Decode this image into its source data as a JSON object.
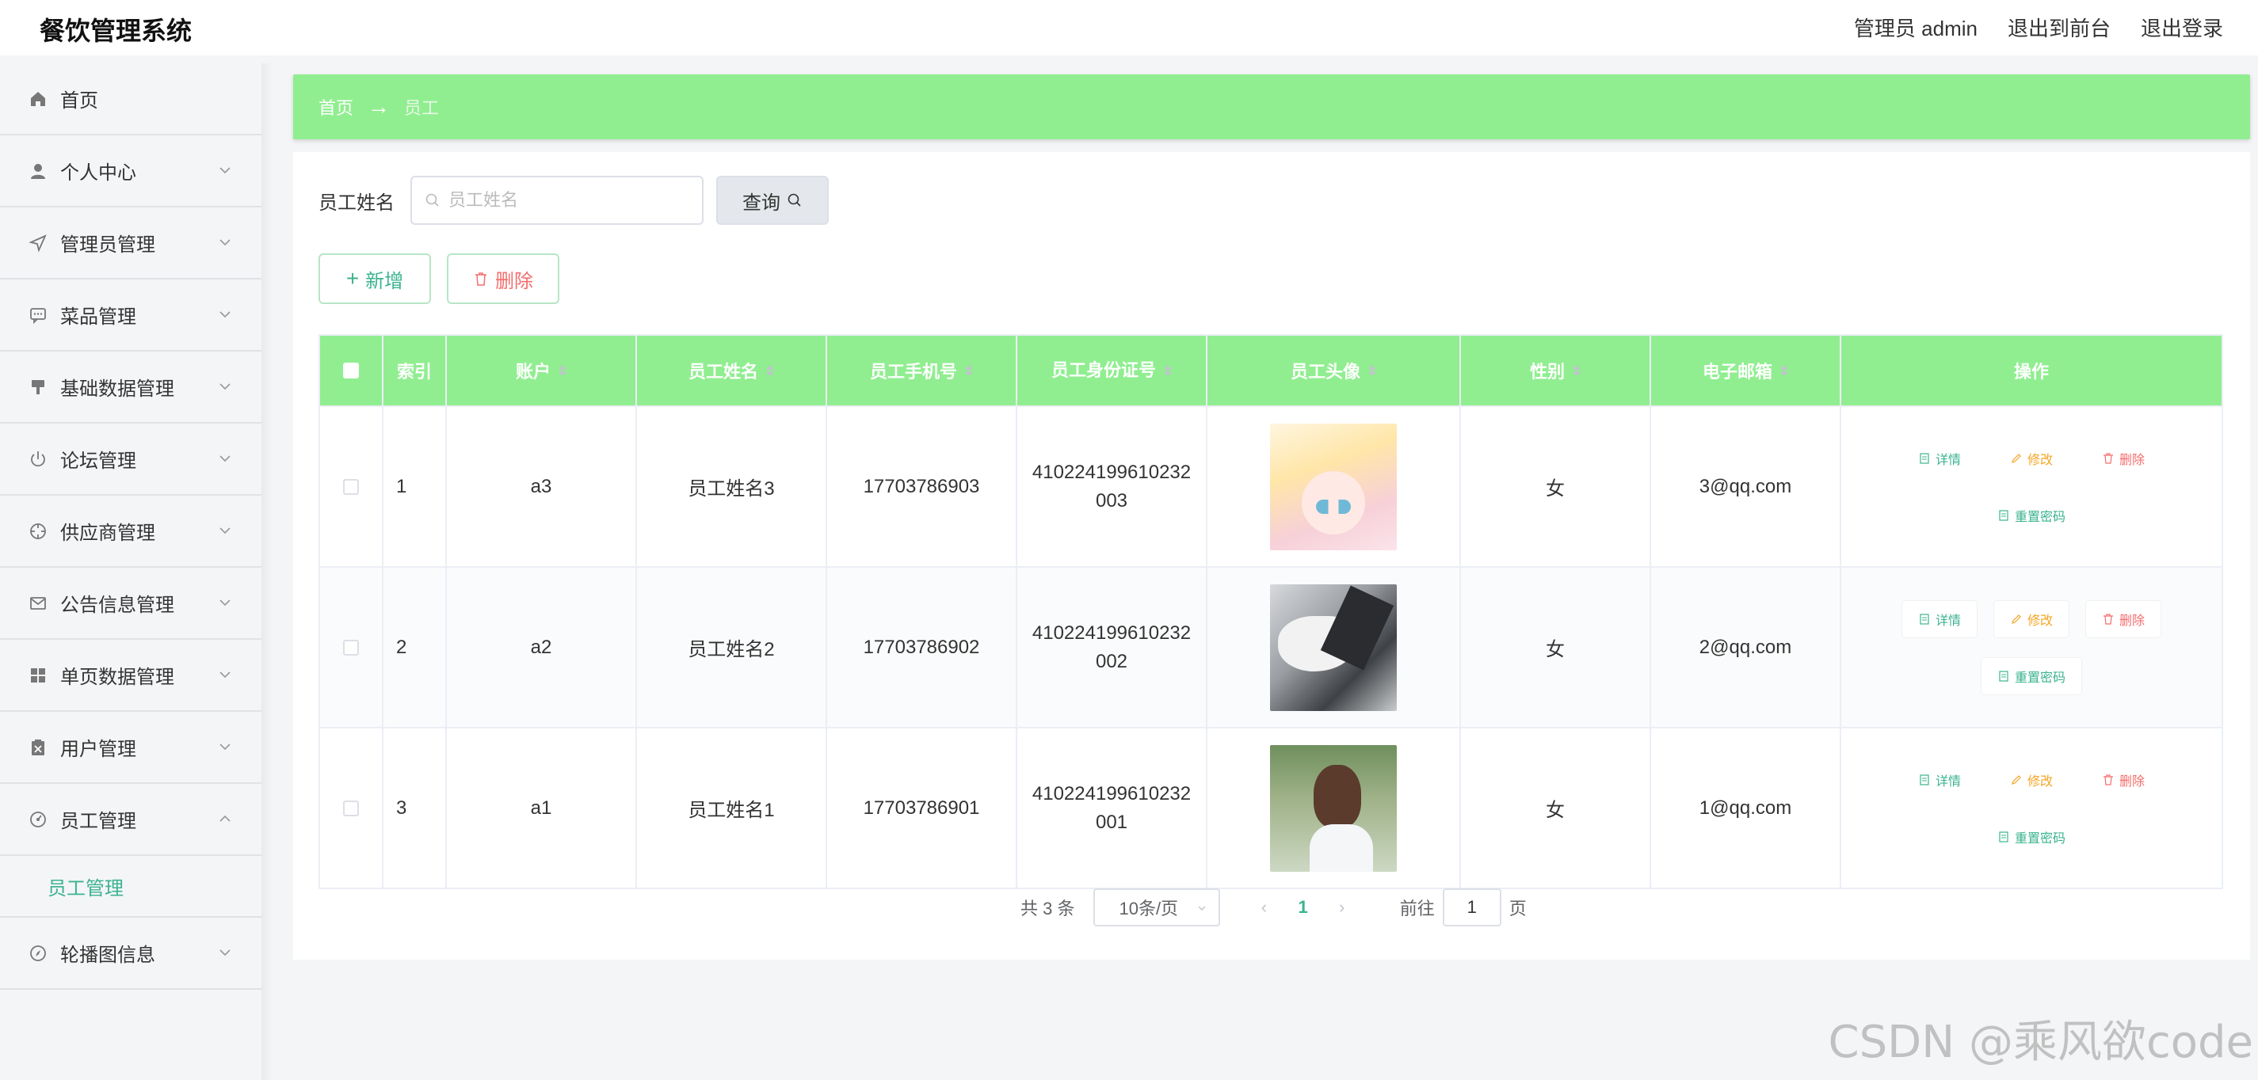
{
  "app": {
    "title": "餐饮管理系统"
  },
  "header": {
    "admin_label": "管理员 admin",
    "to_front": "退出到前台",
    "logout": "退出登录"
  },
  "sidebar": {
    "items": [
      {
        "label": "首页",
        "icon": "home-icon"
      },
      {
        "label": "个人中心",
        "icon": "user-icon"
      },
      {
        "label": "管理员管理",
        "icon": "send-icon"
      },
      {
        "label": "菜品管理",
        "icon": "chat-icon"
      },
      {
        "label": "基础数据管理",
        "icon": "brush-icon"
      },
      {
        "label": "论坛管理",
        "icon": "power-icon"
      },
      {
        "label": "供应商管理",
        "icon": "target-icon"
      },
      {
        "label": "公告信息管理",
        "icon": "mail-icon"
      },
      {
        "label": "单页数据管理",
        "icon": "grid-icon"
      },
      {
        "label": "用户管理",
        "icon": "clipboard-icon"
      },
      {
        "label": "员工管理",
        "icon": "gauge-icon"
      },
      {
        "label": "轮播图信息",
        "icon": "compass-icon"
      }
    ],
    "submenu_label": "员工管理"
  },
  "breadcrumb": {
    "home": "首页",
    "current": "员工"
  },
  "search": {
    "label": "员工姓名",
    "placeholder": "员工姓名",
    "button": "查询"
  },
  "actions": {
    "add": "新增",
    "delete": "删除"
  },
  "table": {
    "columns": [
      "索引",
      "账户",
      "员工姓名",
      "员工手机号",
      "员工身份证号",
      "员工头像",
      "性别",
      "电子邮箱",
      "操作"
    ],
    "rows": [
      {
        "index": "1",
        "account": "a3",
        "name": "员工姓名3",
        "phone": "17703786903",
        "id_line1": "410224199610232",
        "id_line2": "003",
        "sex": "女",
        "email": "3@qq.com"
      },
      {
        "index": "2",
        "account": "a2",
        "name": "员工姓名2",
        "phone": "17703786902",
        "id_line1": "410224199610232",
        "id_line2": "002",
        "sex": "女",
        "email": "2@qq.com"
      },
      {
        "index": "3",
        "account": "a1",
        "name": "员工姓名1",
        "phone": "17703786901",
        "id_line1": "410224199610232",
        "id_line2": "001",
        "sex": "女",
        "email": "1@qq.com"
      }
    ],
    "ops": {
      "detail": "详情",
      "edit": "修改",
      "delete": "删除",
      "reset": "重置密码"
    }
  },
  "pagination": {
    "total": "共 3 条",
    "page_size": "10条/页",
    "current_page": "1",
    "goto_prefix": "前往",
    "goto_value": "1",
    "goto_suffix": "页"
  },
  "watermark": "CSDN @乘风欲code",
  "colors": {
    "accent": "#90ee90",
    "primary_text": "#3bb38f",
    "danger": "#f56c6c",
    "warning": "#f5a623"
  }
}
